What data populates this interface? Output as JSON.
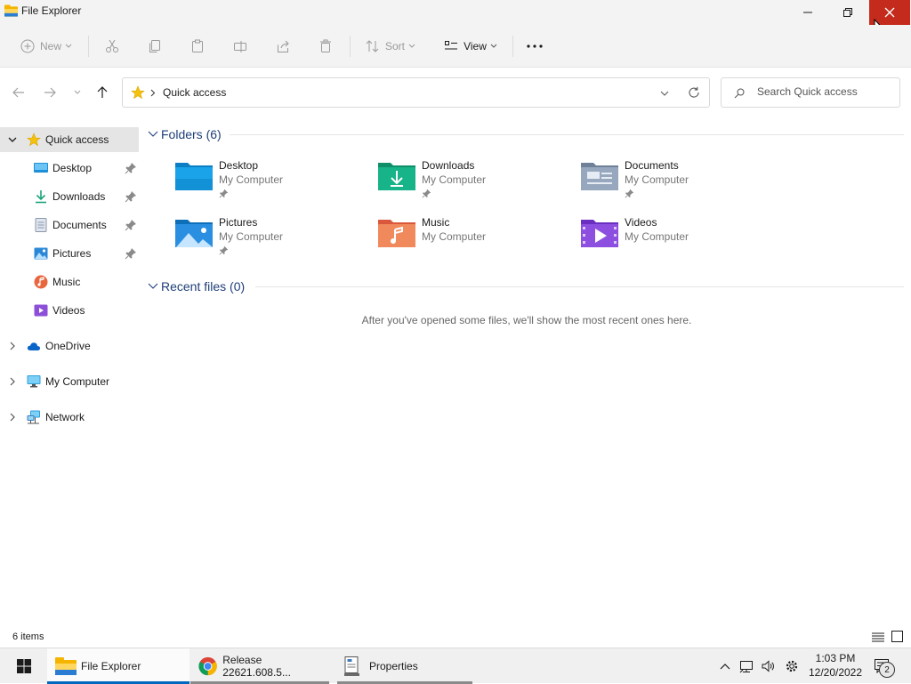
{
  "window": {
    "title": "File Explorer"
  },
  "toolbar": {
    "new_label": "New",
    "sort_label": "Sort",
    "view_label": "View"
  },
  "address": {
    "location": "Quick access"
  },
  "search": {
    "placeholder": "Search Quick access"
  },
  "sidebar": {
    "quick_access": "Quick access",
    "items": [
      {
        "label": "Desktop",
        "icon": "desktop-icon",
        "pinned": true
      },
      {
        "label": "Downloads",
        "icon": "downloads-icon",
        "pinned": true
      },
      {
        "label": "Documents",
        "icon": "documents-icon",
        "pinned": true
      },
      {
        "label": "Pictures",
        "icon": "pictures-icon",
        "pinned": true
      },
      {
        "label": "Music",
        "icon": "music-icon",
        "pinned": false
      },
      {
        "label": "Videos",
        "icon": "videos-icon",
        "pinned": false
      }
    ],
    "onedrive": "OneDrive",
    "my_computer": "My Computer",
    "network": "Network"
  },
  "content": {
    "folders_header": "Folders (6)",
    "folders": [
      {
        "name": "Desktop",
        "location": "My Computer",
        "pinned": true,
        "icon": "desktop-folder-icon"
      },
      {
        "name": "Downloads",
        "location": "My Computer",
        "pinned": true,
        "icon": "downloads-folder-icon"
      },
      {
        "name": "Documents",
        "location": "My Computer",
        "pinned": true,
        "icon": "documents-folder-icon"
      },
      {
        "name": "Pictures",
        "location": "My Computer",
        "pinned": true,
        "icon": "pictures-folder-icon"
      },
      {
        "name": "Music",
        "location": "My Computer",
        "pinned": false,
        "icon": "music-folder-icon"
      },
      {
        "name": "Videos",
        "location": "My Computer",
        "pinned": false,
        "icon": "videos-folder-icon"
      }
    ],
    "recent_header": "Recent files (0)",
    "recent_empty": "After you've opened some files, we'll show the most recent ones here."
  },
  "status": {
    "item_count": "6 items"
  },
  "taskbar": {
    "tasks": [
      {
        "label": "File Explorer",
        "active": true
      },
      {
        "label": "Release 22621.608.5...",
        "active": false
      },
      {
        "label": "Properties",
        "active": false
      }
    ],
    "time": "1:03 PM",
    "date": "12/20/2022",
    "notifications": "2"
  },
  "colors": {
    "accent": "#0067c0",
    "close_hover": "#c42b1c",
    "header_text": "#1f3e78"
  }
}
